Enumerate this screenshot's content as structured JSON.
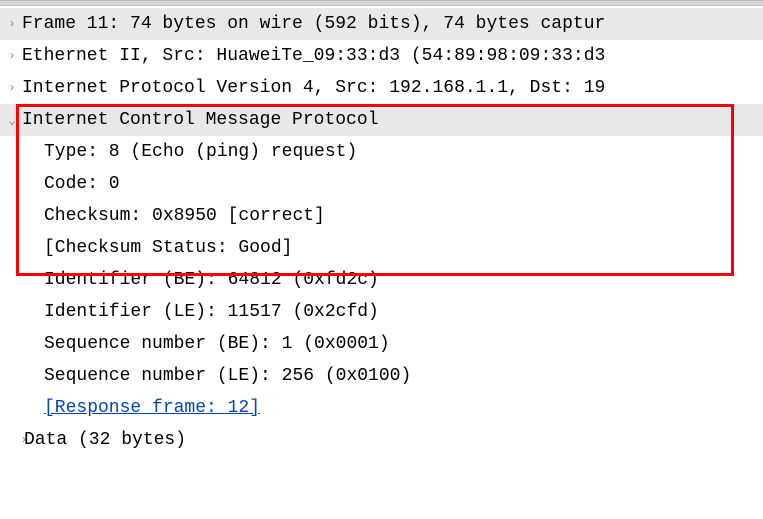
{
  "tree": {
    "frame": "Frame 11: 74 bytes on wire (592 bits), 74 bytes captur",
    "eth": "Ethernet II, Src: HuaweiTe_09:33:d3 (54:89:98:09:33:d3",
    "ip": "Internet Protocol Version 4, Src: 192.168.1.1, Dst: 19",
    "icmp": {
      "header": "Internet Control Message Protocol",
      "type": "Type: 8 (Echo (ping) request)",
      "code": "Code: 0",
      "checksum": "Checksum: 0x8950 [correct]",
      "checksum_status": "[Checksum Status: Good]",
      "id_be": "Identifier (BE): 64812 (0xfd2c)",
      "id_le": "Identifier (LE): 11517 (0x2cfd)",
      "seq_be": "Sequence number (BE): 1 (0x0001)",
      "seq_le": "Sequence number (LE): 256 (0x0100)",
      "response": "[Response frame: 12]",
      "data": "Data (32 bytes)"
    }
  },
  "toggles": {
    "collapsed": "›",
    "expanded": "⌄"
  }
}
